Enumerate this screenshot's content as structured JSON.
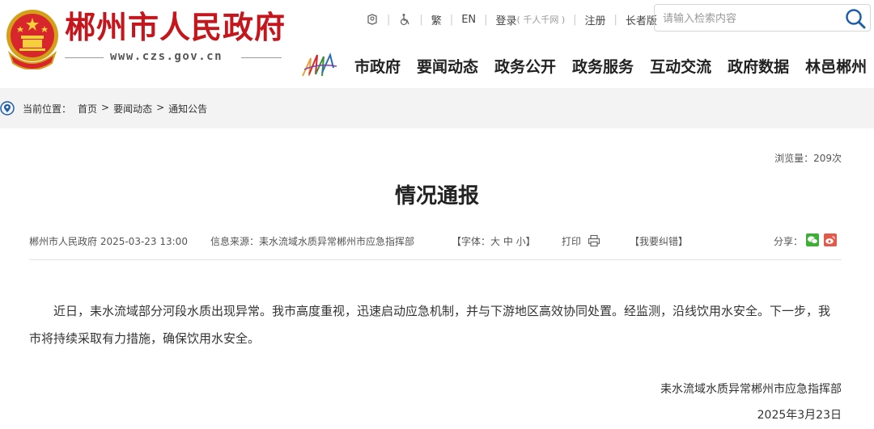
{
  "header": {
    "site_name": "郴州市人民政府",
    "site_domain": "www.czs.gov.cn",
    "utility": {
      "accessibility_icon_name": "accessibility-icon",
      "elder_icon_name": "wheelchair-icon",
      "traditional": "繁",
      "english": "EN",
      "login": "登录",
      "login_sub": "( 千人千网 )",
      "register": "注册",
      "elder_mode": "长者版"
    },
    "search": {
      "placeholder": "请输入检索内容",
      "icon_name": "search-icon"
    },
    "nav": [
      "市政府",
      "要闻动态",
      "政务公开",
      "政务服务",
      "互动交流",
      "政府数据",
      "林邑郴州"
    ],
    "brand_color": "#c4161c"
  },
  "breadcrumb": {
    "label": "当前位置：",
    "items": [
      "首页",
      "要闻动态",
      "通知公告"
    ],
    "separator": ">"
  },
  "article": {
    "views": "浏览量：209次",
    "title": "情况通报",
    "meta": {
      "publisher_date": "郴州市人民政府 2025-03-23 13:00",
      "source": "信息来源：耒水流域水质异常郴州市应急指挥部",
      "font_size": "【字体：大 中 小】",
      "print": "打印",
      "report_error": "【我要纠错】",
      "share": "分享："
    },
    "body": "近日，耒水流域部分河段水质出现异常。我市高度重视，迅速启动应急机制，并与下游地区高效协同处置。经监测，沿线饮用水安全。下一步，我市将持续采取有力措施，确保饮用水安全。",
    "signature": "耒水流域水质异常郴州市应急指挥部",
    "sign_date": "2025年3月23日"
  }
}
